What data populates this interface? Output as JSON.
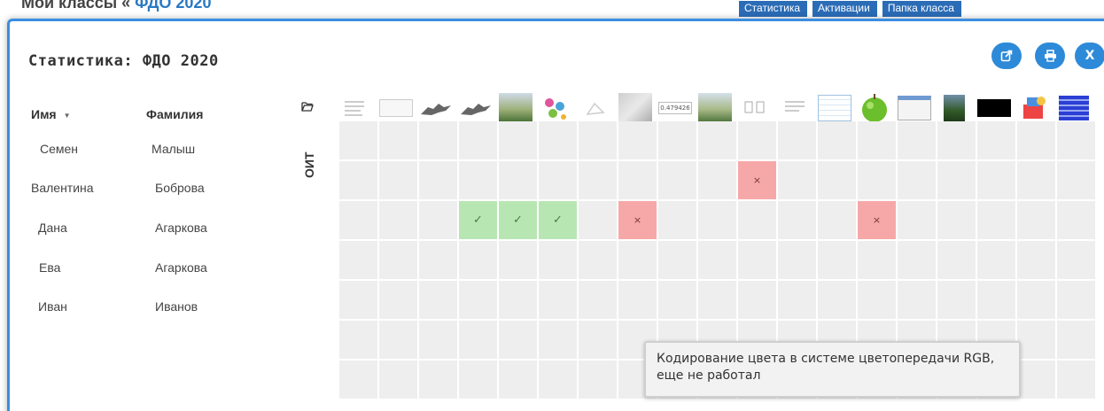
{
  "background": {
    "title_prefix": "Мои классы « ",
    "title_link": "ФДО 2020",
    "menu": [
      "Статистика",
      "Активации",
      "Папка класса"
    ]
  },
  "modal": {
    "title": "Статистика: ФДО 2020",
    "buttons": {
      "open": "open-external",
      "print": "print",
      "close": "X"
    }
  },
  "columns": {
    "first_name": "Имя",
    "last_name": "Фамилия"
  },
  "group_label": "ОИТ",
  "students": [
    {
      "first_name": "Семен",
      "last_name": "Малыш"
    },
    {
      "first_name": "Валентина",
      "last_name": "Боброва"
    },
    {
      "first_name": "Дана",
      "last_name": "Агаркова"
    },
    {
      "first_name": "Ева",
      "last_name": "Агаркова"
    },
    {
      "first_name": "Иван",
      "last_name": "Иванов"
    }
  ],
  "task_thumbs": [
    "doc",
    "text-snippet",
    "horses",
    "horses",
    "landscape",
    "flower",
    "sketch",
    "hill",
    "number",
    "landscape",
    "cards",
    "doc",
    "spreadsheet",
    "apple",
    "window",
    "tree",
    "black",
    "toy",
    "blue-grid"
  ],
  "thumb_number_text": "0.479426",
  "grid": {
    "rows": 7,
    "cols": 19,
    "statuses": [
      {
        "row": 1,
        "col": 10,
        "status": "fail"
      },
      {
        "row": 2,
        "col": 3,
        "status": "ok"
      },
      {
        "row": 2,
        "col": 4,
        "status": "ok"
      },
      {
        "row": 2,
        "col": 5,
        "status": "ok"
      },
      {
        "row": 2,
        "col": 7,
        "status": "fail"
      },
      {
        "row": 2,
        "col": 13,
        "status": "fail"
      }
    ],
    "ok_symbol": "✓",
    "fail_symbol": "×"
  },
  "tooltip": {
    "text": "Кодирование цвета в системе цветопередачи RGB, еще не работал"
  },
  "colors": {
    "accent": "#2d8ad8",
    "ok": "#b8e6b3",
    "fail": "#f6a8a8",
    "cell": "#eeeeee"
  }
}
